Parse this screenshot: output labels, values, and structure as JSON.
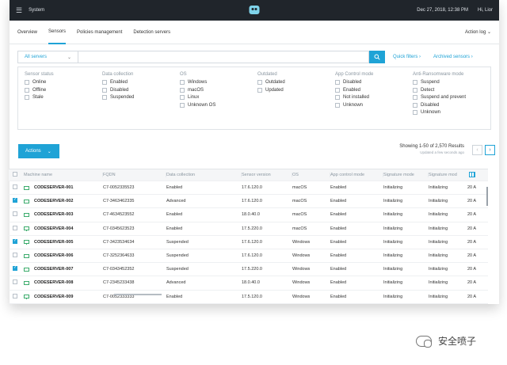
{
  "topbar": {
    "app_title": "System",
    "datetime": "Dec 27, 2018, 12:38 PM",
    "greeting": "Hi, Lior"
  },
  "subnav": {
    "tabs": [
      "Overview",
      "Sensors",
      "Policies management",
      "Detection servers"
    ],
    "action_log": "Action log"
  },
  "filter": {
    "server_select": "All servers",
    "quick_filters": "Quick filters",
    "archived_sensors": "Archived sensors"
  },
  "facets": [
    {
      "title": "Sensor status",
      "options": [
        "Online",
        "Offline",
        "Stale"
      ]
    },
    {
      "title": "Data collection",
      "options": [
        "Enabled",
        "Disabled",
        "Suspended"
      ]
    },
    {
      "title": "OS",
      "options": [
        "Windows",
        "macOS",
        "Linux",
        "Unknown OS"
      ]
    },
    {
      "title": "Outdated",
      "options": [
        "Outdated",
        "Updated"
      ]
    },
    {
      "title": "App Control mode",
      "options": [
        "Disabled",
        "Enabled",
        "Not installed",
        "Unknown"
      ]
    },
    {
      "title": "Anti-Ransomware mode",
      "options": [
        "Suspend",
        "Detect",
        "Suspend and prevent",
        "Disabled",
        "Unknown"
      ]
    }
  ],
  "actions": {
    "label": "Actions"
  },
  "results": {
    "showing": "Showing 1-50 of 2,570 Results",
    "updated": "Updated a few seconds ago"
  },
  "table": {
    "columns": [
      "Machine name",
      "FQDN",
      "Data collection",
      "Sensor version",
      "OS",
      "App control mode",
      "Signature mode",
      "Signature mod"
    ],
    "rows": [
      {
        "checked": false,
        "name": "CODESERVER-001",
        "fqdn": "C7-0052335523",
        "dc": "Enabled",
        "ver": "17.6.120.0",
        "os": "macOS",
        "app": "Enabled",
        "sig": "Initializing",
        "sig2": "Initializing",
        "extra": "20 A"
      },
      {
        "checked": true,
        "name": "CODESERVER-002",
        "fqdn": "C7-3463462335",
        "dc": "Advanced",
        "ver": "17.6.120.0",
        "os": "macOS",
        "app": "Enabled",
        "sig": "Initializing",
        "sig2": "Initializing",
        "extra": "20 A"
      },
      {
        "checked": false,
        "name": "CODESERVER-003",
        "fqdn": "C7-4634523552",
        "dc": "Enabled",
        "ver": "18.0.40.0",
        "os": "macOS",
        "app": "Enabled",
        "sig": "Initializing",
        "sig2": "Initializing",
        "extra": "20 A"
      },
      {
        "checked": false,
        "name": "CODESERVER-004",
        "fqdn": "C7-0345623523",
        "dc": "Enabled",
        "ver": "17.5.220.0",
        "os": "macOS",
        "app": "Enabled",
        "sig": "Initializing",
        "sig2": "Initializing",
        "extra": "20 A"
      },
      {
        "checked": true,
        "name": "CODESERVER-005",
        "fqdn": "C7-3423534634",
        "dc": "Suspended",
        "ver": "17.6.120.0",
        "os": "Windows",
        "app": "Enabled",
        "sig": "Initializing",
        "sig2": "Initializing",
        "extra": "20 A"
      },
      {
        "checked": false,
        "name": "CODESERVER-006",
        "fqdn": "C7-3252364633",
        "dc": "Suspended",
        "ver": "17.6.120.0",
        "os": "Windows",
        "app": "Enabled",
        "sig": "Initializing",
        "sig2": "Initializing",
        "extra": "20 A"
      },
      {
        "checked": true,
        "name": "CODESERVER-007",
        "fqdn": "C7-0343452352",
        "dc": "Suspended",
        "ver": "17.5.220.0",
        "os": "Windows",
        "app": "Enabled",
        "sig": "Initializing",
        "sig2": "Initializing",
        "extra": "20 A"
      },
      {
        "checked": false,
        "name": "CODESERVER-008",
        "fqdn": "C7-2345233438",
        "dc": "Advanced",
        "ver": "18.0.40.0",
        "os": "Windows",
        "app": "Enabled",
        "sig": "Initializing",
        "sig2": "Initializing",
        "extra": "20 A"
      },
      {
        "checked": false,
        "name": "CODESERVER-009",
        "fqdn": "C7-0052333333",
        "dc": "Enabled",
        "ver": "17.5.120.0",
        "os": "Windows",
        "app": "Enabled",
        "sig": "Initializing",
        "sig2": "Initializing",
        "extra": "20 A"
      }
    ]
  },
  "watermark": {
    "text": "安全喷子"
  }
}
